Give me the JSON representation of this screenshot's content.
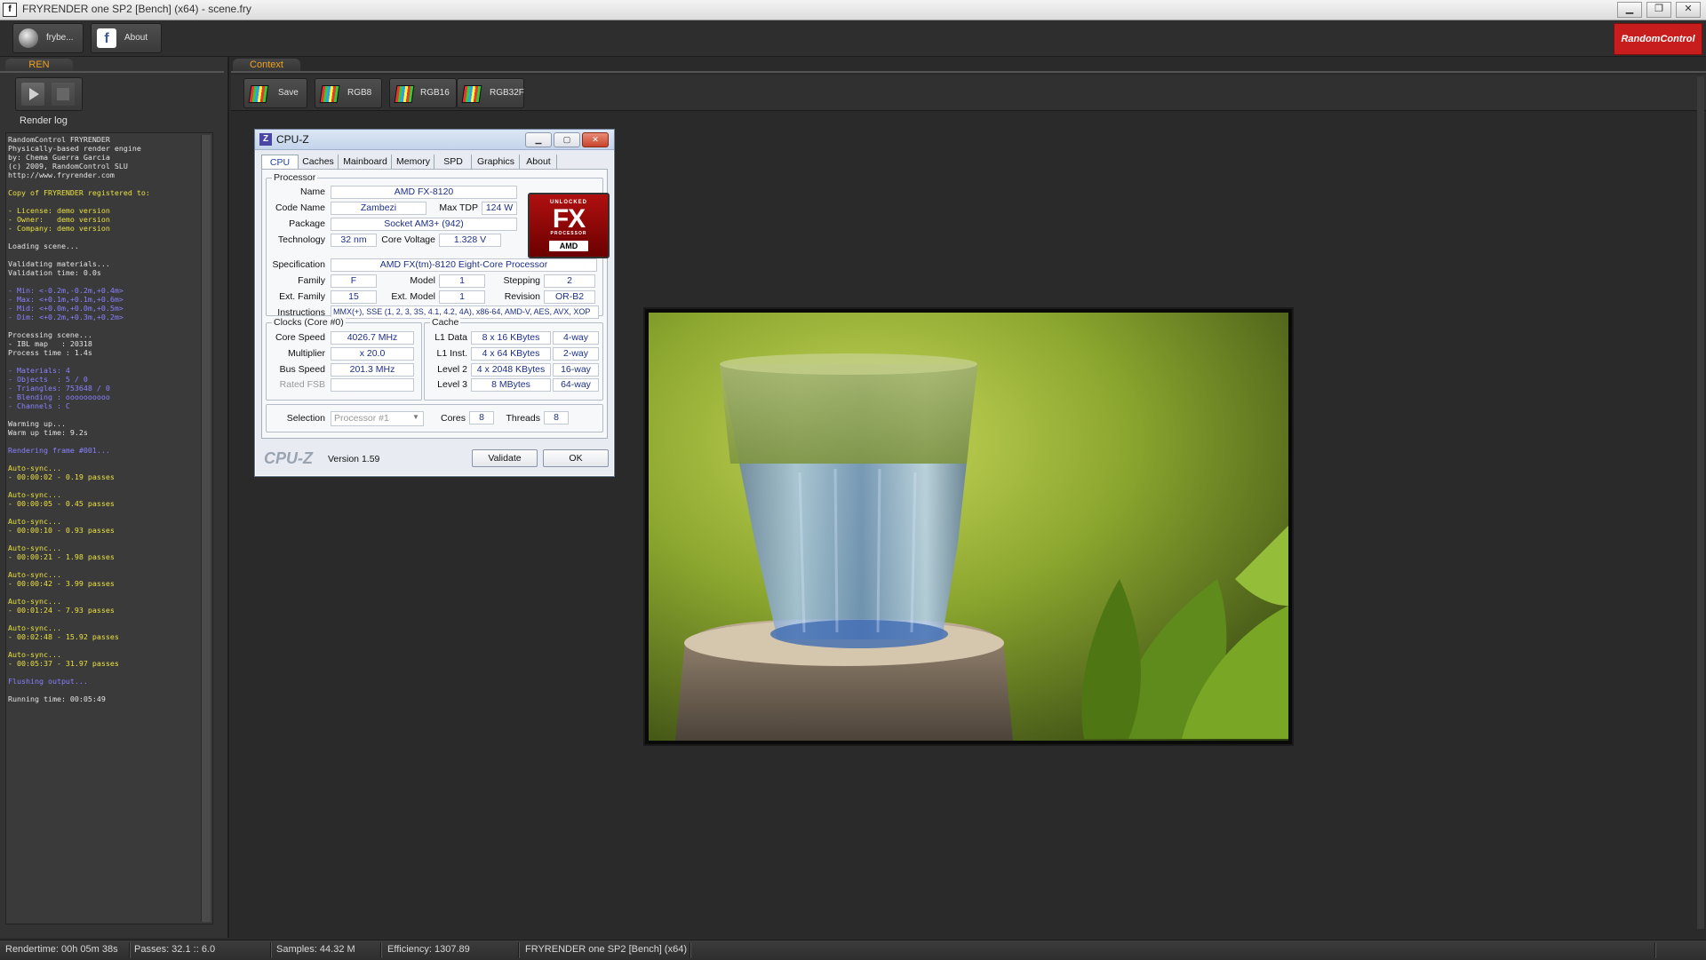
{
  "window": {
    "title": "FRYRENDER one SP2 [Bench] (x64) - scene.fry",
    "icon_letter": "f",
    "buttons": {
      "minimize": "▁",
      "restore": "❐",
      "close": "✕"
    }
  },
  "top_toolbar": {
    "user_button": {
      "label": "frybe...",
      "icon": "user-icon"
    },
    "about_button": {
      "label": "About",
      "icon": "facebook-icon"
    },
    "brand_logo": "RandomControl"
  },
  "left_panel": {
    "tab": "REN",
    "render_log_title": "Render log",
    "log": [
      {
        "t": "RandomControl FRYRENDER",
        "c": "white"
      },
      {
        "t": "Physically-based render engine",
        "c": "white"
      },
      {
        "t": "by: Chema Guerra Garcia",
        "c": "white"
      },
      {
        "t": "(c) 2009, RandomControl SLU",
        "c": "white"
      },
      {
        "t": "http://www.fryrender.com",
        "c": "white"
      },
      {
        "t": "",
        "c": "white"
      },
      {
        "t": "Copy of FRYRENDER registered to:",
        "c": "yellow"
      },
      {
        "t": "",
        "c": "white"
      },
      {
        "t": "- License: demo version",
        "c": "yellow"
      },
      {
        "t": "- Owner:   demo version",
        "c": "yellow"
      },
      {
        "t": "- Company: demo version",
        "c": "yellow"
      },
      {
        "t": "",
        "c": "white"
      },
      {
        "t": "Loading scene...",
        "c": "white"
      },
      {
        "t": "",
        "c": "white"
      },
      {
        "t": "Validating materials...",
        "c": "white"
      },
      {
        "t": "Validation time: 0.0s",
        "c": "white"
      },
      {
        "t": "",
        "c": "white"
      },
      {
        "t": "- Min: <-0.2m,-0.2m,+0.4m>",
        "c": "blue"
      },
      {
        "t": "- Max: <+0.1m,+0.1m,+0.6m>",
        "c": "blue"
      },
      {
        "t": "- Mid: <+0.0m,+0.0m,+0.5m>",
        "c": "blue"
      },
      {
        "t": "- Dim: <+0.2m,+0.3m,+0.2m>",
        "c": "blue"
      },
      {
        "t": "",
        "c": "white"
      },
      {
        "t": "Processing scene...",
        "c": "white"
      },
      {
        "t": "- IBL map   : 20318",
        "c": "white"
      },
      {
        "t": "Process time : 1.4s",
        "c": "white"
      },
      {
        "t": "",
        "c": "white"
      },
      {
        "t": "- Materials: 4",
        "c": "blue"
      },
      {
        "t": "- Objects  : 5 / 0",
        "c": "blue"
      },
      {
        "t": "- Triangles: 753648 / 0",
        "c": "blue"
      },
      {
        "t": "- Blending : oooooooooo",
        "c": "blue"
      },
      {
        "t": "- Channels : C",
        "c": "blue"
      },
      {
        "t": "",
        "c": "white"
      },
      {
        "t": "Warming up...",
        "c": "white"
      },
      {
        "t": "Warm up time: 9.2s",
        "c": "white"
      },
      {
        "t": "",
        "c": "white"
      },
      {
        "t": "Rendering frame #001...",
        "c": "blue"
      },
      {
        "t": "",
        "c": "white"
      },
      {
        "t": "Auto-sync...",
        "c": "yellow"
      },
      {
        "t": "- 00:00:02 - 0.19 passes",
        "c": "yellow"
      },
      {
        "t": "",
        "c": "white"
      },
      {
        "t": "Auto-sync...",
        "c": "yellow"
      },
      {
        "t": "- 00:00:05 - 0.45 passes",
        "c": "yellow"
      },
      {
        "t": "",
        "c": "white"
      },
      {
        "t": "Auto-sync...",
        "c": "yellow"
      },
      {
        "t": "- 00:00:10 - 0.93 passes",
        "c": "yellow"
      },
      {
        "t": "",
        "c": "white"
      },
      {
        "t": "Auto-sync...",
        "c": "yellow"
      },
      {
        "t": "- 00:00:21 - 1.98 passes",
        "c": "yellow"
      },
      {
        "t": "",
        "c": "white"
      },
      {
        "t": "Auto-sync...",
        "c": "yellow"
      },
      {
        "t": "- 00:00:42 - 3.99 passes",
        "c": "yellow"
      },
      {
        "t": "",
        "c": "white"
      },
      {
        "t": "Auto-sync...",
        "c": "yellow"
      },
      {
        "t": "- 00:01:24 - 7.93 passes",
        "c": "yellow"
      },
      {
        "t": "",
        "c": "white"
      },
      {
        "t": "Auto-sync...",
        "c": "yellow"
      },
      {
        "t": "- 00:02:48 - 15.92 passes",
        "c": "yellow"
      },
      {
        "t": "",
        "c": "white"
      },
      {
        "t": "Auto-sync...",
        "c": "yellow"
      },
      {
        "t": "- 00:05:37 - 31.97 passes",
        "c": "yellow"
      },
      {
        "t": "",
        "c": "white"
      },
      {
        "t": "Flushing output...",
        "c": "blue"
      },
      {
        "t": "",
        "c": "white"
      },
      {
        "t": "Running time: 00:05:49",
        "c": "white"
      }
    ]
  },
  "context_panel": {
    "tab": "Context",
    "buttons": [
      {
        "label": "Save",
        "icon": "save-icon"
      },
      {
        "label": "RGB8",
        "icon": "rgb8-icon"
      },
      {
        "label": "RGB16",
        "icon": "rgb16-icon"
      },
      {
        "label": "RGB32F",
        "icon": "rgb32f-icon"
      }
    ]
  },
  "cpuz": {
    "title": "CPU-Z",
    "icon_letter": "Z",
    "tabs": [
      "CPU",
      "Caches",
      "Mainboard",
      "Memory",
      "SPD",
      "Graphics",
      "About"
    ],
    "active_tab": "CPU",
    "processor": {
      "group": "Processor",
      "name_label": "Name",
      "name": "AMD FX-8120",
      "codename_label": "Code Name",
      "codename": "Zambezi",
      "maxtdp_label": "Max TDP",
      "maxtdp": "124 W",
      "package_label": "Package",
      "package": "Socket AM3+ (942)",
      "technology_label": "Technology",
      "technology": "32 nm",
      "corevoltage_label": "Core Voltage",
      "corevoltage": "1.328 V",
      "spec_label": "Specification",
      "spec": "AMD FX(tm)-8120 Eight-Core Processor",
      "family_label": "Family",
      "family": "F",
      "model_label": "Model",
      "model": "1",
      "stepping_label": "Stepping",
      "stepping": "2",
      "extfamily_label": "Ext. Family",
      "extfamily": "15",
      "extmodel_label": "Ext. Model",
      "extmodel": "1",
      "revision_label": "Revision",
      "revision": "OR-B2",
      "instructions_label": "Instructions",
      "instructions": "MMX(+), SSE (1, 2, 3, 3S, 4.1, 4.2, 4A), x86-64, AMD-V, AES, AVX, XOP",
      "logo": {
        "top": "UNLOCKED",
        "big": "FX",
        "sub": "PROCESSOR",
        "brand": "AMD"
      }
    },
    "clocks": {
      "group": "Clocks (Core #0)",
      "corespeed_label": "Core Speed",
      "corespeed": "4026.7 MHz",
      "multiplier_label": "Multiplier",
      "multiplier": "x 20.0",
      "busspeed_label": "Bus Speed",
      "busspeed": "201.3 MHz",
      "ratedfsb_label": "Rated FSB",
      "ratedfsb": ""
    },
    "cache": {
      "group": "Cache",
      "rows": [
        {
          "label": "L1 Data",
          "size": "8 x 16 KBytes",
          "way": "4-way"
        },
        {
          "label": "L1 Inst.",
          "size": "4 x 64 KBytes",
          "way": "2-way"
        },
        {
          "label": "Level 2",
          "size": "4 x 2048 KBytes",
          "way": "16-way"
        },
        {
          "label": "Level 3",
          "size": "8 MBytes",
          "way": "64-way"
        }
      ]
    },
    "selection_label": "Selection",
    "selection": "Processor #1",
    "cores_label": "Cores",
    "cores": "8",
    "threads_label": "Threads",
    "threads": "8",
    "brand": "CPU-Z",
    "version": "Version 1.59",
    "validate_button": "Validate",
    "ok_button": "OK"
  },
  "statusbar": {
    "rendertime": "Rendertime:  00h 05m 38s",
    "passes": "Passes:  32.1 :: 6.0",
    "samples": "Samples:  44.32 M",
    "efficiency": "Efficiency:  1307.89",
    "product": "FRYRENDER one SP2 [Bench] (x64)"
  },
  "colors": {
    "accent_orange": "#f0a020",
    "brand_red": "#c81d1d",
    "log_yellow": "#e8e040",
    "log_blue": "#8a80ff",
    "cpuz_value_blue": "#1c2f8a"
  }
}
